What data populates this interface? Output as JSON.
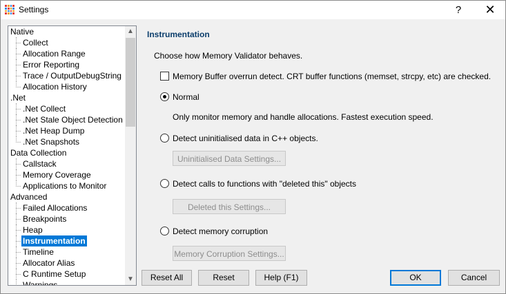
{
  "window": {
    "title": "Settings",
    "help_glyph": "?",
    "close_glyph": "✕"
  },
  "tree": {
    "items": [
      {
        "label": "Native",
        "level": 0
      },
      {
        "label": "Collect",
        "level": 1
      },
      {
        "label": "Allocation Range",
        "level": 1
      },
      {
        "label": "Error Reporting",
        "level": 1
      },
      {
        "label": "Trace / OutputDebugString",
        "level": 1
      },
      {
        "label": "Allocation History",
        "level": 1
      },
      {
        "label": ".Net",
        "level": 0
      },
      {
        "label": ".Net Collect",
        "level": 1
      },
      {
        "label": ".Net Stale Object Detection",
        "level": 1
      },
      {
        "label": ".Net Heap Dump",
        "level": 1
      },
      {
        "label": ".Net Snapshots",
        "level": 1
      },
      {
        "label": "Data Collection",
        "level": 0
      },
      {
        "label": "Callstack",
        "level": 1
      },
      {
        "label": "Memory Coverage",
        "level": 1
      },
      {
        "label": "Applications to Monitor",
        "level": 1
      },
      {
        "label": "Advanced",
        "level": 0
      },
      {
        "label": "Failed Allocations",
        "level": 1
      },
      {
        "label": "Breakpoints",
        "level": 1
      },
      {
        "label": "Heap",
        "level": 1
      },
      {
        "label": "Instrumentation",
        "level": 1,
        "selected": true
      },
      {
        "label": "Timeline",
        "level": 1
      },
      {
        "label": "Allocator Alias",
        "level": 1
      },
      {
        "label": "C Runtime Setup",
        "level": 1
      },
      {
        "label": "Warnings",
        "level": 1
      }
    ]
  },
  "panel": {
    "title": "Instrumentation",
    "intro": "Choose how Memory Validator behaves.",
    "checkbox_label": "Memory Buffer overrun detect. CRT buffer functions (memset, strcpy, etc) are checked.",
    "checkbox_checked": false,
    "radio_normal": "Normal",
    "normal_desc": "Only monitor memory and handle allocations. Fastest execution speed.",
    "radio_uninit": "Detect uninitialised data in C++ objects.",
    "uninit_button": "Uninitialised Data Settings...",
    "radio_deleted": "Detect calls to functions with \"deleted this\" objects",
    "deleted_button": "Deleted this Settings...",
    "radio_corruption": "Detect memory corruption",
    "corruption_button": "Memory Corruption Settings...",
    "selected_mode": "Normal"
  },
  "buttons": {
    "reset_all": "Reset All",
    "reset": "Reset",
    "help": "Help (F1)",
    "ok": "OK",
    "cancel": "Cancel"
  },
  "colors": {
    "accent": "#0078d7",
    "section_title": "#0b3d6b"
  }
}
